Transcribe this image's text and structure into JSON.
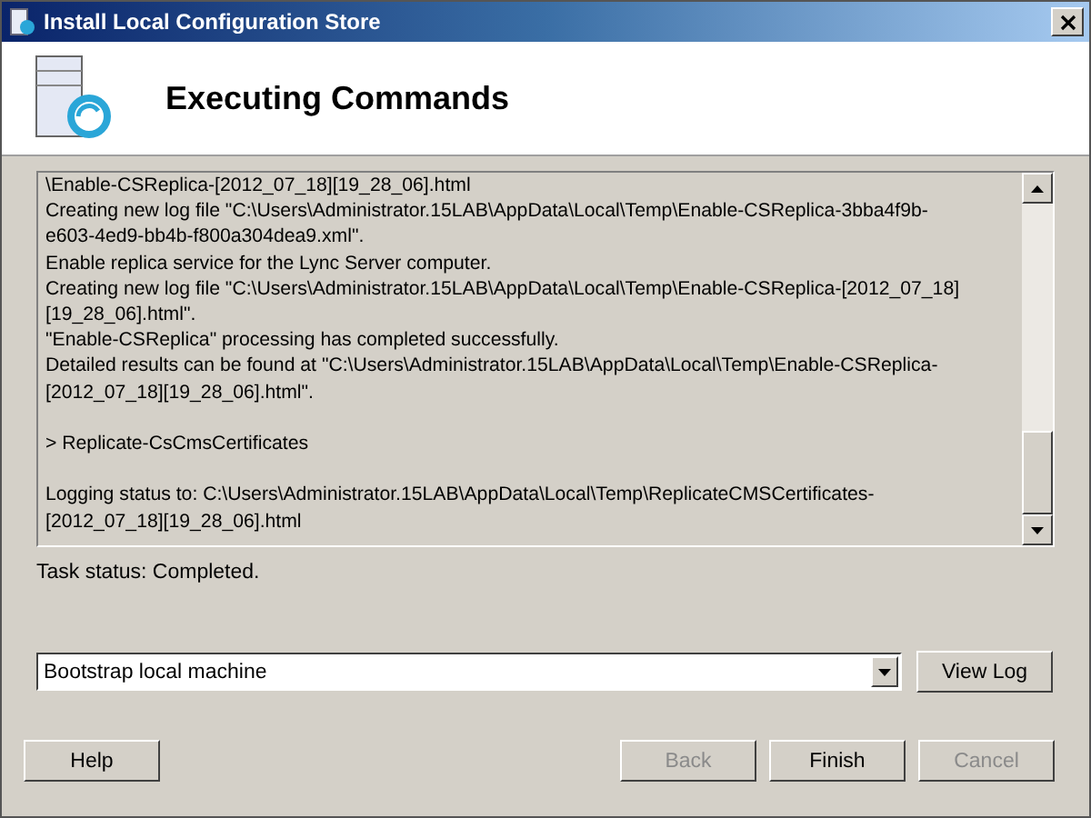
{
  "window": {
    "title": "Install Local Configuration Store"
  },
  "header": {
    "title": "Executing Commands"
  },
  "log": {
    "blocks": [
      [
        "\\Enable-CSReplica-[2012_07_18][19_28_06].html",
        "Creating new log file \"C:\\Users\\Administrator.15LAB\\AppData\\Local\\Temp\\Enable-CSReplica-3bba4f9b-",
        "e603-4ed9-bb4b-f800a304dea9.xml\".",
        "Enable replica service for the Lync Server computer.",
        "Creating new log file \"C:\\Users\\Administrator.15LAB\\AppData\\Local\\Temp\\Enable-CSReplica-[2012_07_18]",
        "[19_28_06].html\".",
        "\"Enable-CSReplica\" processing has completed successfully.",
        "Detailed results can be found at \"C:\\Users\\Administrator.15LAB\\AppData\\Local\\Temp\\Enable-CSReplica-",
        "[2012_07_18][19_28_06].html\"."
      ],
      [
        "> Replicate-CsCmsCertificates"
      ],
      [
        "Logging status to: C:\\Users\\Administrator.15LAB\\AppData\\Local\\Temp\\ReplicateCMSCertificates-",
        "[2012_07_18][19_28_06].html"
      ]
    ]
  },
  "task_status": "Task status: Completed.",
  "dropdown": {
    "value": "Bootstrap local machine"
  },
  "view_log_button": {
    "label": "View Log",
    "disabled": false
  },
  "buttons": [
    {
      "label": "Help",
      "disabled": false
    },
    {
      "label": "Back",
      "disabled": true
    },
    {
      "label": "Finish",
      "disabled": false
    },
    {
      "label": "Cancel",
      "disabled": true
    }
  ]
}
